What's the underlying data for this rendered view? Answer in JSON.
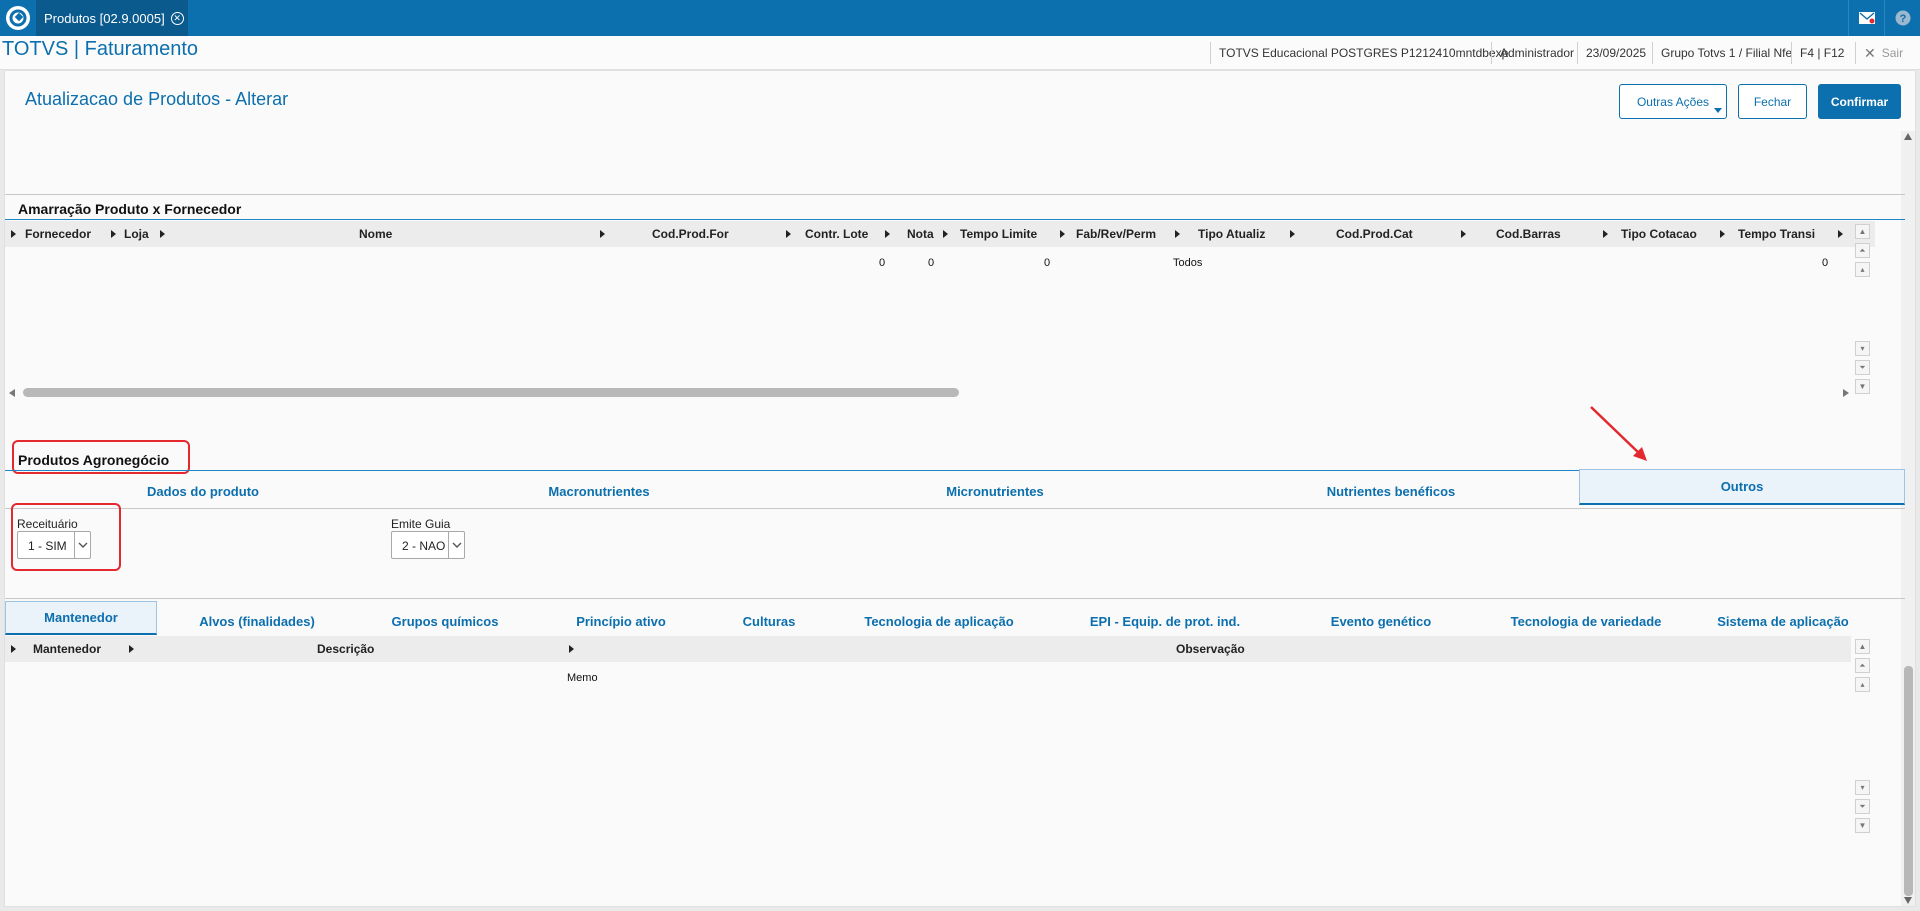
{
  "app": {
    "tab_title": "Produtos [02.9.0005]",
    "title": "TOTVS | Faturamento"
  },
  "header": {
    "environment": "TOTVS Educacional POSTGRES P1212410mntdbexp",
    "user": "Administrador",
    "date": "23/09/2025",
    "branch": "Grupo Totvs 1 / Filial Nfe",
    "keys": "F4 | F12",
    "sair": "Sair"
  },
  "page": {
    "title": "Atualizacao de Produtos - Alterar",
    "btn_outras": "Outras Ações",
    "btn_fechar": "Fechar",
    "btn_confirmar": "Confirmar"
  },
  "amarracao": {
    "title": "Amarração Produto x Fornecedor",
    "columns": [
      "Fornecedor",
      "Loja",
      "Nome",
      "Cod.Prod.For",
      "Contr. Lote",
      "Nota",
      "Tempo Limite",
      "Fab/Rev/Perm",
      "Tipo Atualiz",
      "Cod.Prod.Cat",
      "Cod.Barras",
      "Tipo Cotacao",
      "Tempo Transi"
    ],
    "row": {
      "contr_lote": "0",
      "nota": "0",
      "tempo_limite": "0",
      "tipo_atualiz": "Todos",
      "tempo_transi": "0"
    }
  },
  "agro": {
    "title": "Produtos Agronegócio",
    "tabs": [
      "Dados do produto",
      "Macronutrientes",
      "Micronutrientes",
      "Nutrientes benéficos",
      "Outros"
    ],
    "receituario_label": "Receituário",
    "receituario_value": "1 - SIM",
    "emite_guia_label": "Emite Guia",
    "emite_guia_value": "2 - NAO"
  },
  "subtabs": [
    "Mantenedor",
    "Alvos (finalidades)",
    "Grupos químicos",
    "Princípio ativo",
    "Culturas",
    "Tecnologia de aplicação",
    "EPI - Equip. de prot. ind.",
    "Evento genético",
    "Tecnologia de variedade",
    "Sistema de aplicação"
  ],
  "mantenedor": {
    "columns": [
      "Mantenedor",
      "Descrição",
      "Observação"
    ],
    "row": {
      "observacao": "Memo"
    }
  },
  "colors": {
    "brand": "#0c6fae",
    "highlight": "#e3282e"
  }
}
